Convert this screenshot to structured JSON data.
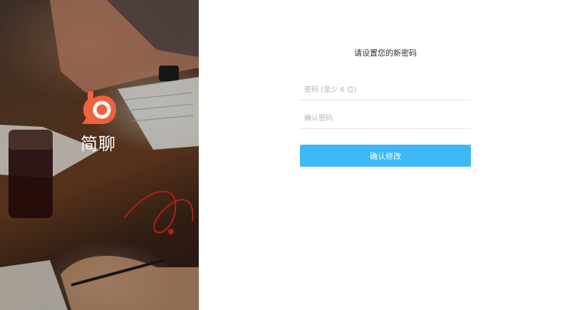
{
  "brand": {
    "name": "简聊",
    "logo_icon": "chat-bubble-b-icon",
    "accent_color": "#f0613d"
  },
  "form": {
    "title": "请设置您的新密码",
    "password_placeholder": "密码 (至少 6 位)",
    "confirm_placeholder": "确认密码",
    "submit_label": "确认修改",
    "button_color": "#3fb8f6"
  }
}
